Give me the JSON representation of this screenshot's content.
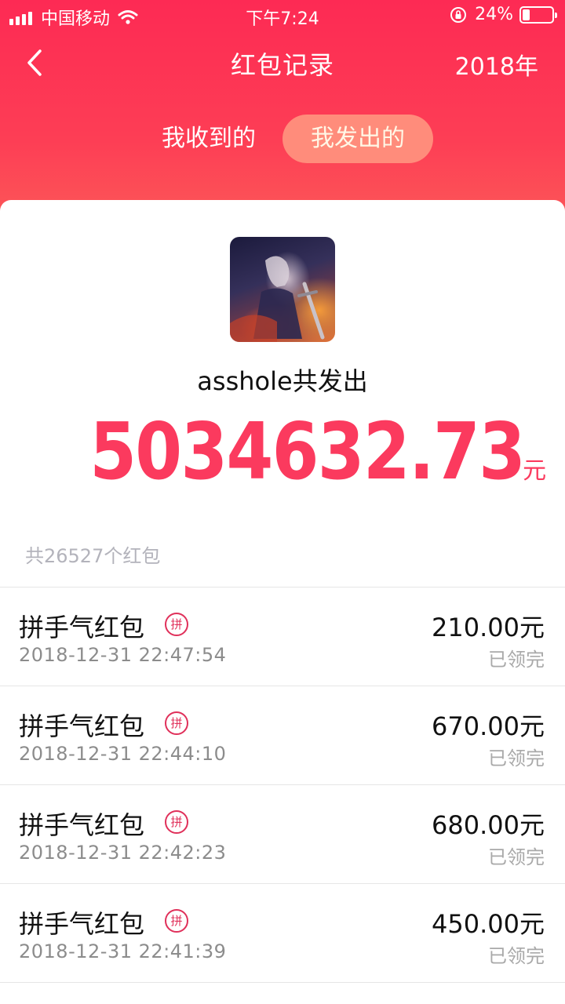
{
  "status_bar": {
    "carrier": "中国移动",
    "time": "下午7:24",
    "battery": "24%",
    "battery_level": 0.24
  },
  "nav": {
    "title": "红包记录",
    "year": "2018年",
    "back_icon": "chevron-left-icon"
  },
  "tabs": [
    {
      "label": "我收到的",
      "active": false
    },
    {
      "label": "我发出的",
      "active": true
    }
  ],
  "summary": {
    "sender_text": "asshole共发出",
    "total": "5034632.73",
    "unit": "元",
    "count_text": "共26527个红包"
  },
  "records": [
    {
      "name": "拼手气红包",
      "badge": "拼",
      "time": "2018-12-31 22:47:54",
      "amount": "210.00元",
      "status": "已领完"
    },
    {
      "name": "拼手气红包",
      "badge": "拼",
      "time": "2018-12-31 22:44:10",
      "amount": "670.00元",
      "status": "已领完"
    },
    {
      "name": "拼手气红包",
      "badge": "拼",
      "time": "2018-12-31 22:42:23",
      "amount": "680.00元",
      "status": "已领完"
    },
    {
      "name": "拼手气红包",
      "badge": "拼",
      "time": "2018-12-31 22:41:39",
      "amount": "450.00元",
      "status": "已领完"
    }
  ],
  "colors": {
    "header_top": "#fd2a54",
    "header_bottom": "#fc5b58",
    "accent": "#fb3a5e",
    "active_tab_bg": "#ff8c7b"
  }
}
